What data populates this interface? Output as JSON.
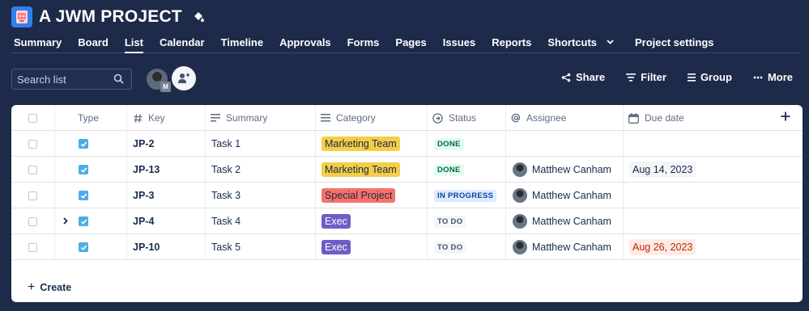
{
  "project": {
    "title": "A JWM PROJECT",
    "icon": "project-avatar-icon"
  },
  "tabs": [
    {
      "label": "Summary"
    },
    {
      "label": "Board"
    },
    {
      "label": "List"
    },
    {
      "label": "Calendar"
    },
    {
      "label": "Timeline"
    },
    {
      "label": "Approvals"
    },
    {
      "label": "Forms"
    },
    {
      "label": "Pages"
    },
    {
      "label": "Issues"
    },
    {
      "label": "Reports"
    },
    {
      "label": "Shortcuts"
    },
    {
      "label": "Project settings"
    }
  ],
  "active_tab": "List",
  "search": {
    "placeholder": "Search list"
  },
  "avatar_badge": "M",
  "actions": {
    "share": "Share",
    "filter": "Filter",
    "group": "Group",
    "more": "More"
  },
  "columns": {
    "type": "Type",
    "key": "Key",
    "summary": "Summary",
    "category": "Category",
    "status": "Status",
    "assignee": "Assignee",
    "due_date": "Due date"
  },
  "rows": [
    {
      "key": "JP-2",
      "summary": "Task 1",
      "category": "Marketing Team",
      "category_color": "#f5cd47",
      "status": "DONE",
      "status_style": "done",
      "assignee": "",
      "due": "",
      "due_style": ""
    },
    {
      "key": "JP-13",
      "summary": "Task 2",
      "category": "Marketing Team",
      "category_color": "#f5cd47",
      "status": "DONE",
      "status_style": "done",
      "assignee": "Matthew Canham",
      "due": "Aug 14, 2023",
      "due_style": "normal"
    },
    {
      "key": "JP-3",
      "summary": "Task 3",
      "category": "Special Project",
      "category_color": "#f87168",
      "status": "IN PROGRESS",
      "status_style": "progress",
      "assignee": "Matthew Canham",
      "due": "",
      "due_style": ""
    },
    {
      "key": "JP-4",
      "summary": "Task 4",
      "category": "Exec",
      "category_color": "#6e5dc6",
      "status": "TO DO",
      "status_style": "todo",
      "assignee": "Matthew Canham",
      "due": "",
      "due_style": "",
      "has_children": true
    },
    {
      "key": "JP-10",
      "summary": "Task 5",
      "category": "Exec",
      "category_color": "#6e5dc6",
      "status": "TO DO",
      "status_style": "todo",
      "assignee": "Matthew Canham",
      "due": "Aug 26, 2023",
      "due_style": "overdue"
    }
  ],
  "create_label": "Create",
  "colors": {
    "background": "#1d2a4a",
    "task_icon": "#4bade8",
    "done_bg": "#e3fcef",
    "done_text": "#006644",
    "progress_bg": "#deebff",
    "progress_text": "#0747a6",
    "todo_bg": "#f4f5f7",
    "todo_text": "#42526e",
    "overdue_bg": "#ffebe6",
    "overdue_text": "#bf2600"
  }
}
